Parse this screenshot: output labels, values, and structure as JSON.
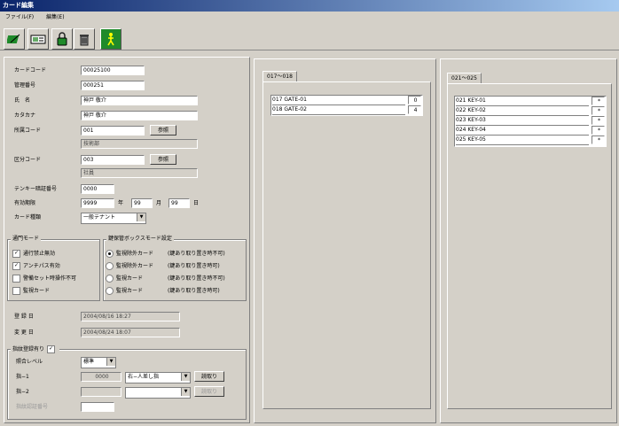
{
  "window": {
    "title": "カード編集"
  },
  "menu": [
    "ファイル(F)",
    "編集(E)"
  ],
  "card": {
    "card_code_label": "カードコード",
    "card_code": "00025100",
    "mgmt_no_label": "管理番号",
    "mgmt_no": "000251",
    "name_label": "氏　名",
    "name": "神戸 敬介",
    "kana_label": "カタカナ",
    "kana": "神戸 敬介",
    "dept_code_label": "所属コード",
    "dept_code": "001",
    "dept_ref": "参照",
    "dept_name": "技術部",
    "class_code_label": "区分コード",
    "class_code": "003",
    "class_ref": "参照",
    "class_name": "社員",
    "tenkey_label": "テンキー暗証番号",
    "tenkey": "0000",
    "expiry_label": "有効期限",
    "expiry_year": "9999",
    "year_unit": "年",
    "expiry_month": "99",
    "month_unit": "月",
    "expiry_day": "99",
    "day_unit": "日",
    "card_type_label": "カード種類",
    "card_type": "一般テナント"
  },
  "door_mode": {
    "title": "通門モード",
    "items": [
      {
        "label": "通行禁止無効",
        "checked": true
      },
      {
        "label": "アンチパス有効",
        "checked": true
      },
      {
        "label": "警備セット時操作不可",
        "checked": false
      },
      {
        "label": "監視カード",
        "checked": false
      }
    ]
  },
  "keybox": {
    "title": "鍵保管ボックスモード設定",
    "items": [
      {
        "label": "監視除外カード",
        "note": "(鍵あり取り置き時不可)",
        "on": true
      },
      {
        "label": "監視除外カード",
        "note": "(鍵あり取り置き時可)",
        "on": false
      },
      {
        "label": "監視カード",
        "note": "(鍵あり取り置き時不可)",
        "on": false
      },
      {
        "label": "監視カード",
        "note": "(鍵あり取り置き時可)",
        "on": false
      }
    ]
  },
  "dates": {
    "registered_label": "登 録 日",
    "registered": "2004/08/16 18:27",
    "changed_label": "変 更 日",
    "changed": "2004/08/24 18:07"
  },
  "fingerprint": {
    "title": "指紋登録有り",
    "checked": true,
    "level_label": "照合レベル",
    "level": "標準",
    "f1_label": "指−1",
    "f1_value": "0000",
    "f1_select": "右−人差し指",
    "f1_button": "読取り",
    "f2_label": "指−2",
    "f2_value": "",
    "f2_select": "",
    "f2_button": "読取り",
    "pin_label": "指紋認証番号",
    "pin": ""
  },
  "gate_panel": {
    "tab": "017〜018",
    "rows": [
      {
        "label": "017 GATE-01",
        "value": "0"
      },
      {
        "label": "018 GATE-02",
        "value": "4"
      }
    ]
  },
  "key_panel": {
    "tab": "021〜025",
    "rows": [
      {
        "label": "021 KEY-01",
        "value": "*"
      },
      {
        "label": "022 KEY-02",
        "value": "*"
      },
      {
        "label": "023 KEY-03",
        "value": "*"
      },
      {
        "label": "024 KEY-04",
        "value": "*"
      },
      {
        "label": "025 KEY-05",
        "value": "*"
      }
    ]
  },
  "colors": {
    "title_start": "#0a246a",
    "title_end": "#a6caf0",
    "face": "#d4d0c8",
    "tool_green": "#1f8a2a"
  },
  "icons": [
    "card-edit-icon",
    "card-reader-icon",
    "lock-icon",
    "trash-icon",
    "exit-person-icon"
  ]
}
